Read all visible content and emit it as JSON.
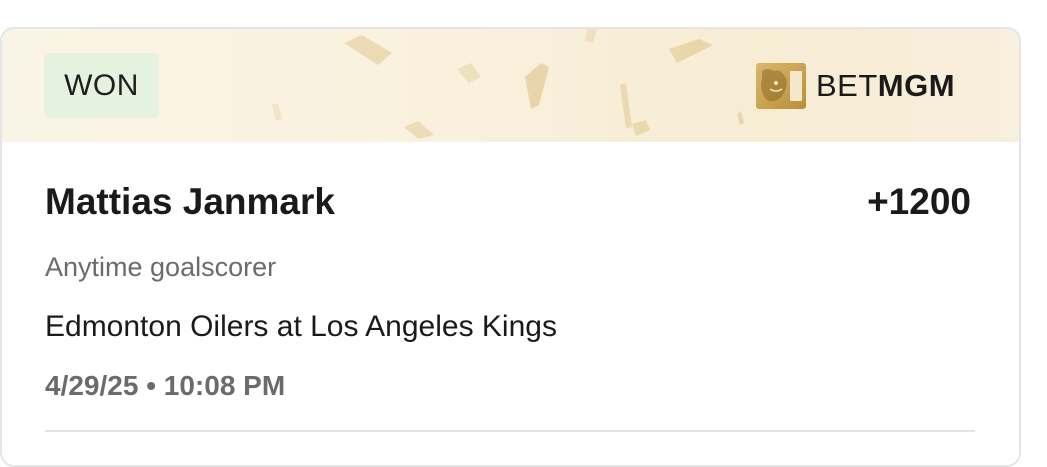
{
  "bet": {
    "status": "WON",
    "status_color": "#e4f2df",
    "player": "Mattias Janmark",
    "odds": "+1200",
    "market": "Anytime goalscorer",
    "matchup": "Edmonton Oilers at Los Angeles Kings",
    "datetime": "4/29/25 • 10:08 PM"
  },
  "brand": {
    "prefix": "BET",
    "suffix": "MGM",
    "logo_icon": "lion-icon",
    "accent": "#c9a24c"
  },
  "banner": {
    "background": "#f9f1dd",
    "decoration": "confetti"
  }
}
